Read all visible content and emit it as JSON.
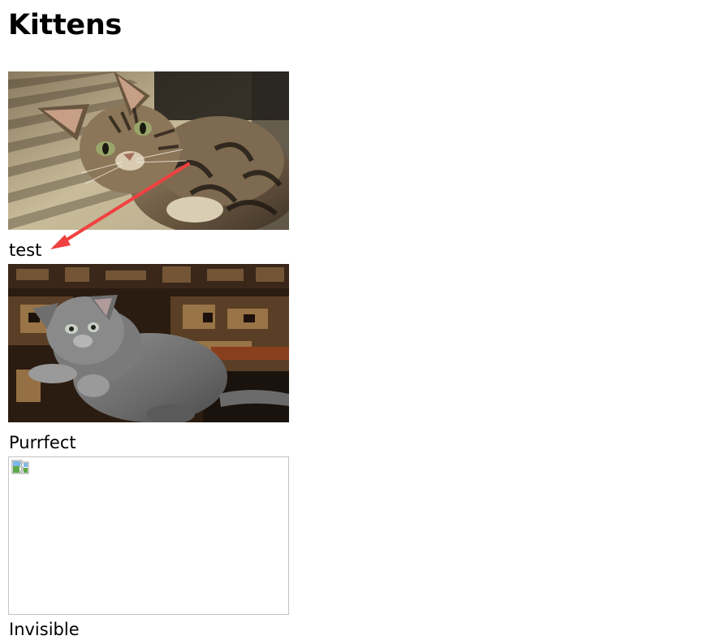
{
  "page": {
    "title": "Kittens"
  },
  "items": [
    {
      "caption": "test",
      "image": "tabby-kitten-photo"
    },
    {
      "caption": "Purrfect",
      "image": "gray-kitten-photo"
    },
    {
      "caption": "Invisible",
      "image": "broken-image-placeholder"
    }
  ],
  "colors": {
    "annotation_arrow": "#f04040",
    "broken_border": "#c4c4c4"
  }
}
